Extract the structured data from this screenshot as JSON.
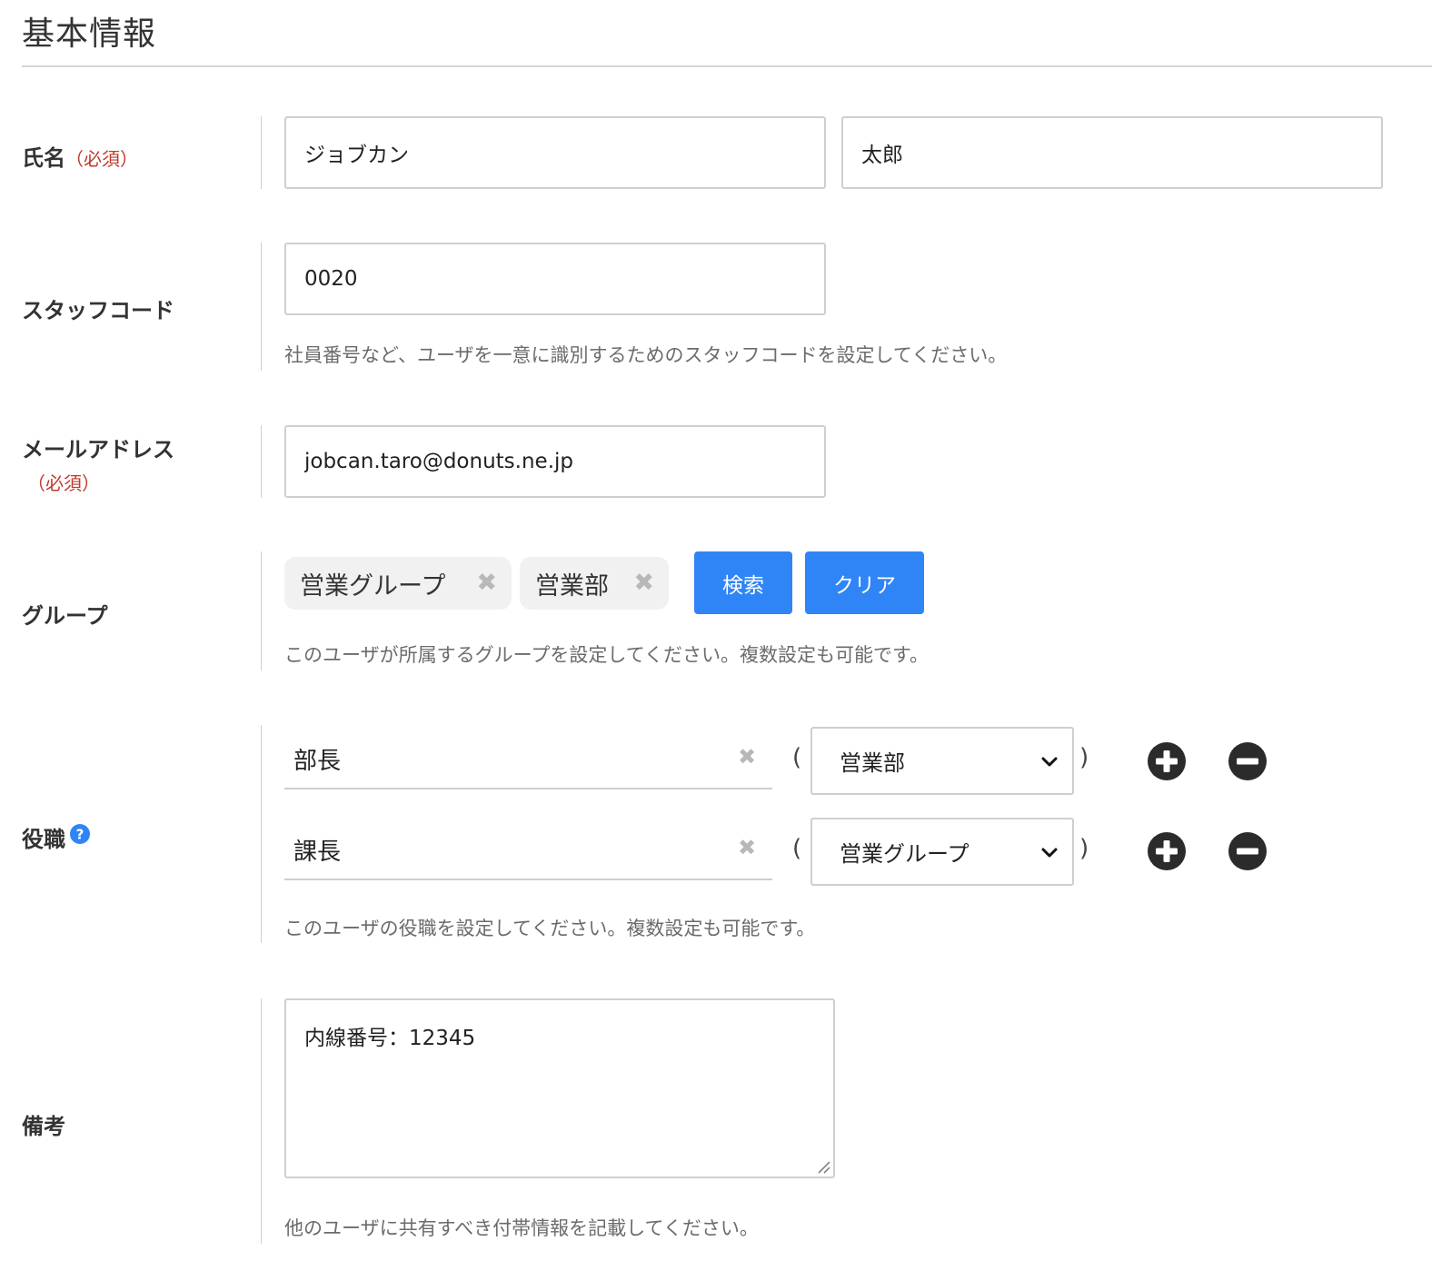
{
  "section": {
    "title": "基本情報"
  },
  "name": {
    "label": "氏名",
    "required": "（必須）",
    "last_name": "ジョブカン",
    "first_name": "太郎"
  },
  "staff_code": {
    "label": "スタッフコード",
    "value": "0020",
    "help": "社員番号など、ユーザを一意に識別するためのスタッフコードを設定してください。"
  },
  "email": {
    "label": "メールアドレス",
    "required": "（必須）",
    "value": "jobcan.taro@donuts.ne.jp"
  },
  "group": {
    "label": "グループ",
    "chips": [
      {
        "label": "営業グループ",
        "remove": "✖"
      },
      {
        "label": "営業部",
        "remove": "✖"
      }
    ],
    "search_button": "検索",
    "clear_button": "クリア",
    "help": "このユーザが所属するグループを設定してください。複数設定も可能です。"
  },
  "position": {
    "label": "役職",
    "rows": [
      {
        "title": "部長",
        "clear": "✖",
        "open_paren": "(",
        "group": "営業部",
        "close_paren": ")"
      },
      {
        "title": "課長",
        "clear": "✖",
        "open_paren": "(",
        "group": "営業グループ",
        "close_paren": ")"
      }
    ],
    "icons": {
      "help": "question-circle-icon",
      "add": "plus-circle-icon",
      "remove": "minus-circle-icon"
    },
    "help": "このユーザの役職を設定してください。複数設定も可能です。"
  },
  "notes": {
    "label": "備考",
    "value": "内線番号：12345",
    "help": "他のユーザに共有すべき付帯情報を記載してください。"
  },
  "colors": {
    "accent": "#2f85f5",
    "required": "#c0392b",
    "icon_dark": "#2b2b2b",
    "help_text": "#6b6b6b"
  }
}
